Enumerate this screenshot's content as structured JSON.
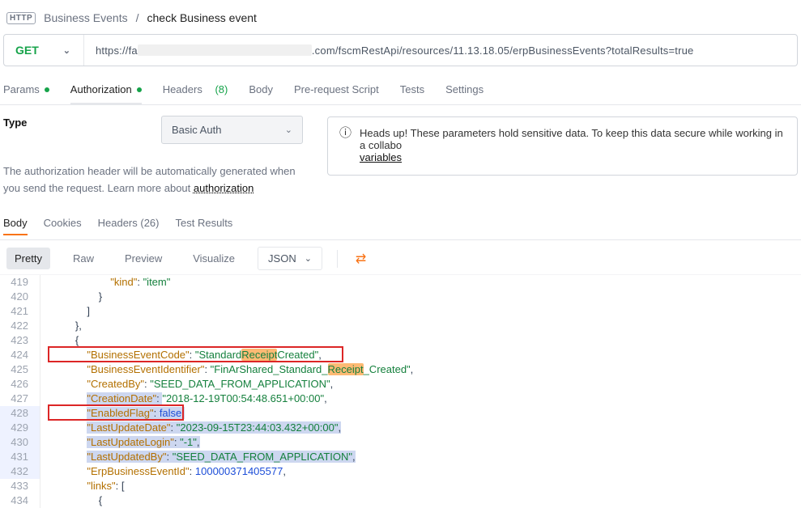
{
  "breadcrumb": {
    "parent": "Business Events",
    "sep": "/",
    "current": "check Business event"
  },
  "req": {
    "method": "GET",
    "url_pre": "https://fa",
    "url_blurred": true,
    "url_post": ".com/fscmRestApi/resources/11.13.18.05/erpBusinessEvents?totalResults=true"
  },
  "rtabs": {
    "params": "Params",
    "authorization": "Authorization",
    "headers": "Headers",
    "headers_count": "(8)",
    "body": "Body",
    "prereq": "Pre-request Script",
    "tests": "Tests",
    "settings": "Settings"
  },
  "auth": {
    "type_label": "Type",
    "type_value": "Basic Auth",
    "helper_text": "The authorization header will be automatically generated when you send the request. Learn more about ",
    "helper_link": "authorization",
    "banner": "Heads up! These parameters hold sensitive data. To keep this data secure while working in a collabo",
    "variables": "variables"
  },
  "resp": {
    "body": "Body",
    "cookies": "Cookies",
    "headers": "Headers",
    "headers_count": "(26)",
    "test_results": "Test Results"
  },
  "view": {
    "pretty": "Pretty",
    "raw": "Raw",
    "preview": "Preview",
    "visualize": "Visualize",
    "format": "JSON"
  },
  "code_lines": [
    {
      "n": 419,
      "indent": 20,
      "k": "\"kind\"",
      "v": "\"item\""
    },
    {
      "n": 420,
      "indent": 16,
      "raw": "}"
    },
    {
      "n": 421,
      "indent": 12,
      "raw": "]"
    },
    {
      "n": 422,
      "indent": 8,
      "raw": "},"
    },
    {
      "n": 423,
      "indent": 8,
      "raw": "{"
    },
    {
      "n": 424,
      "indent": 12,
      "k": "\"BusinessEventCode\"",
      "v": "\"Standard",
      "hl": "Receipt",
      "v2": "Created\"",
      "comma": true,
      "rbox": 1
    },
    {
      "n": 425,
      "indent": 12,
      "k": "\"BusinessEventIdentifier\"",
      "v": "\"FinArShared_Standard_",
      "hl": "Receipt",
      "v2": "_Created\"",
      "comma": true
    },
    {
      "n": 426,
      "indent": 12,
      "k": "\"CreatedBy\"",
      "v": "\"SEED_DATA_FROM_APPLICATION\"",
      "comma": true
    },
    {
      "n": 427,
      "indent": 12,
      "k": "\"CreationDate\"",
      "v": "\"2018-12-19T00:54:48.651+00:00\"",
      "comma": true,
      "sel_k": true
    },
    {
      "n": 428,
      "indent": 12,
      "k": "\"EnabledFlag\"",
      "bool": "false",
      "comma": true,
      "sel": true,
      "rbox": 2,
      "ghl": true
    },
    {
      "n": 429,
      "indent": 12,
      "k": "\"LastUpdateDate\"",
      "v": "\"2023-09-15T23:44:03.432+00:00\"",
      "comma": true,
      "sel": true,
      "ghl": true
    },
    {
      "n": 430,
      "indent": 12,
      "k": "\"LastUpdateLogin\"",
      "v": "\"-1\"",
      "comma": true,
      "sel": true,
      "ghl": true
    },
    {
      "n": 431,
      "indent": 12,
      "k": "\"LastUpdatedBy\"",
      "v": "\"SEED_DATA_FROM_APPLICATION\"",
      "comma": true,
      "sel": true,
      "ghl": true
    },
    {
      "n": 432,
      "indent": 12,
      "k": "\"ErpBusinessEventId\"",
      "num": "100000371405577",
      "comma": true,
      "ghl": true
    },
    {
      "n": 433,
      "indent": 12,
      "k": "\"links\"",
      "raw2": "["
    },
    {
      "n": 434,
      "indent": 16,
      "raw": "{"
    }
  ]
}
